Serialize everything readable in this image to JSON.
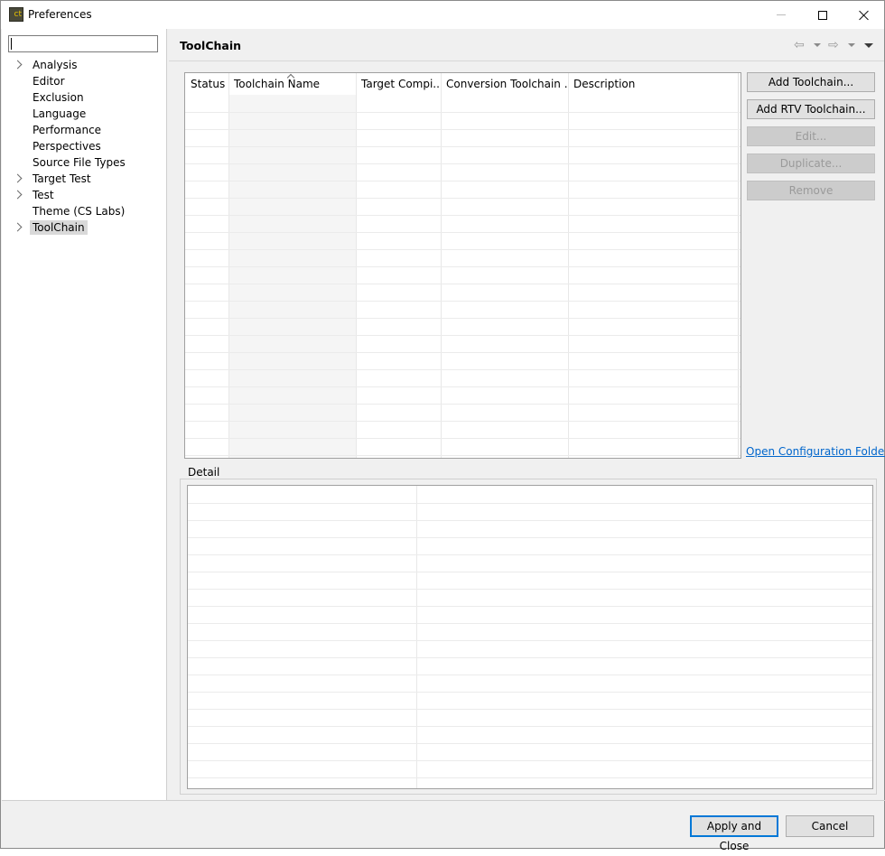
{
  "window": {
    "title": "Preferences",
    "icon_text": "ct"
  },
  "sidebar": {
    "filter_value": "",
    "items": [
      {
        "label": "Analysis",
        "expandable": true,
        "selected": false
      },
      {
        "label": "Editor",
        "expandable": false,
        "selected": false
      },
      {
        "label": "Exclusion",
        "expandable": false,
        "selected": false
      },
      {
        "label": "Language",
        "expandable": false,
        "selected": false
      },
      {
        "label": "Performance",
        "expandable": false,
        "selected": false
      },
      {
        "label": "Perspectives",
        "expandable": false,
        "selected": false
      },
      {
        "label": "Source File Types",
        "expandable": false,
        "selected": false
      },
      {
        "label": "Target Test",
        "expandable": true,
        "selected": false
      },
      {
        "label": "Test",
        "expandable": true,
        "selected": false
      },
      {
        "label": "Theme (CS Labs)",
        "expandable": false,
        "selected": false
      },
      {
        "label": "ToolChain",
        "expandable": true,
        "selected": true
      }
    ]
  },
  "page": {
    "title": "ToolChain"
  },
  "toolchain_table": {
    "columns": [
      "Status",
      "Toolchain Name",
      "Target Compi...",
      "Conversion Toolchain ...",
      "Description"
    ],
    "sorted_column": "Toolchain Name",
    "rows": []
  },
  "actions": {
    "add_toolchain": "Add Toolchain...",
    "add_rtv_toolchain": "Add RTV Toolchain...",
    "edit": "Edit...",
    "duplicate": "Duplicate...",
    "remove": "Remove",
    "open_config_folder": "Open Configuration Folder"
  },
  "detail": {
    "label": "Detail",
    "rows": []
  },
  "footer": {
    "apply_and_close": "Apply and Close",
    "cancel": "Cancel"
  }
}
